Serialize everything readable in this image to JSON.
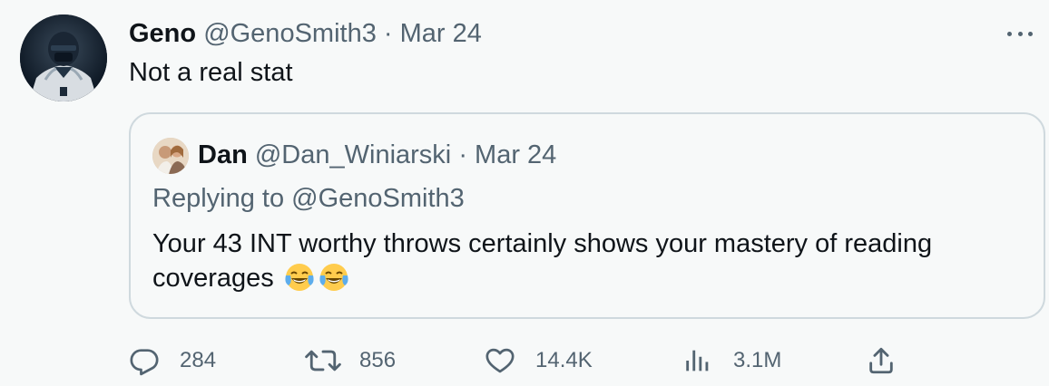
{
  "tweet": {
    "author_name": "Geno",
    "author_handle": "@GenoSmith3",
    "separator": "·",
    "date": "Mar 24",
    "text": "Not a real stat"
  },
  "quote": {
    "author_name": "Dan",
    "author_handle": "@Dan_Winiarski",
    "separator": "·",
    "date": "Mar 24",
    "replying_prefix": "Replying to ",
    "replying_to": "@GenoSmith3",
    "text": "Your 43 INT worthy throws certainly shows your mastery of reading coverages",
    "emojis": [
      "face-with-tears-of-joy",
      "face-with-tears-of-joy"
    ]
  },
  "actions": {
    "replies": "284",
    "retweets": "856",
    "likes": "14.4K",
    "views": "3.1M"
  },
  "icons": {
    "reply": "reply-icon",
    "retweet": "retweet-icon",
    "like": "heart-icon",
    "views": "views-icon",
    "share": "share-icon",
    "more": "more-icon"
  },
  "colors": {
    "background": "#f7f9f9",
    "text_primary": "#0f1419",
    "text_secondary": "#536471",
    "border": "#cfd9de"
  }
}
